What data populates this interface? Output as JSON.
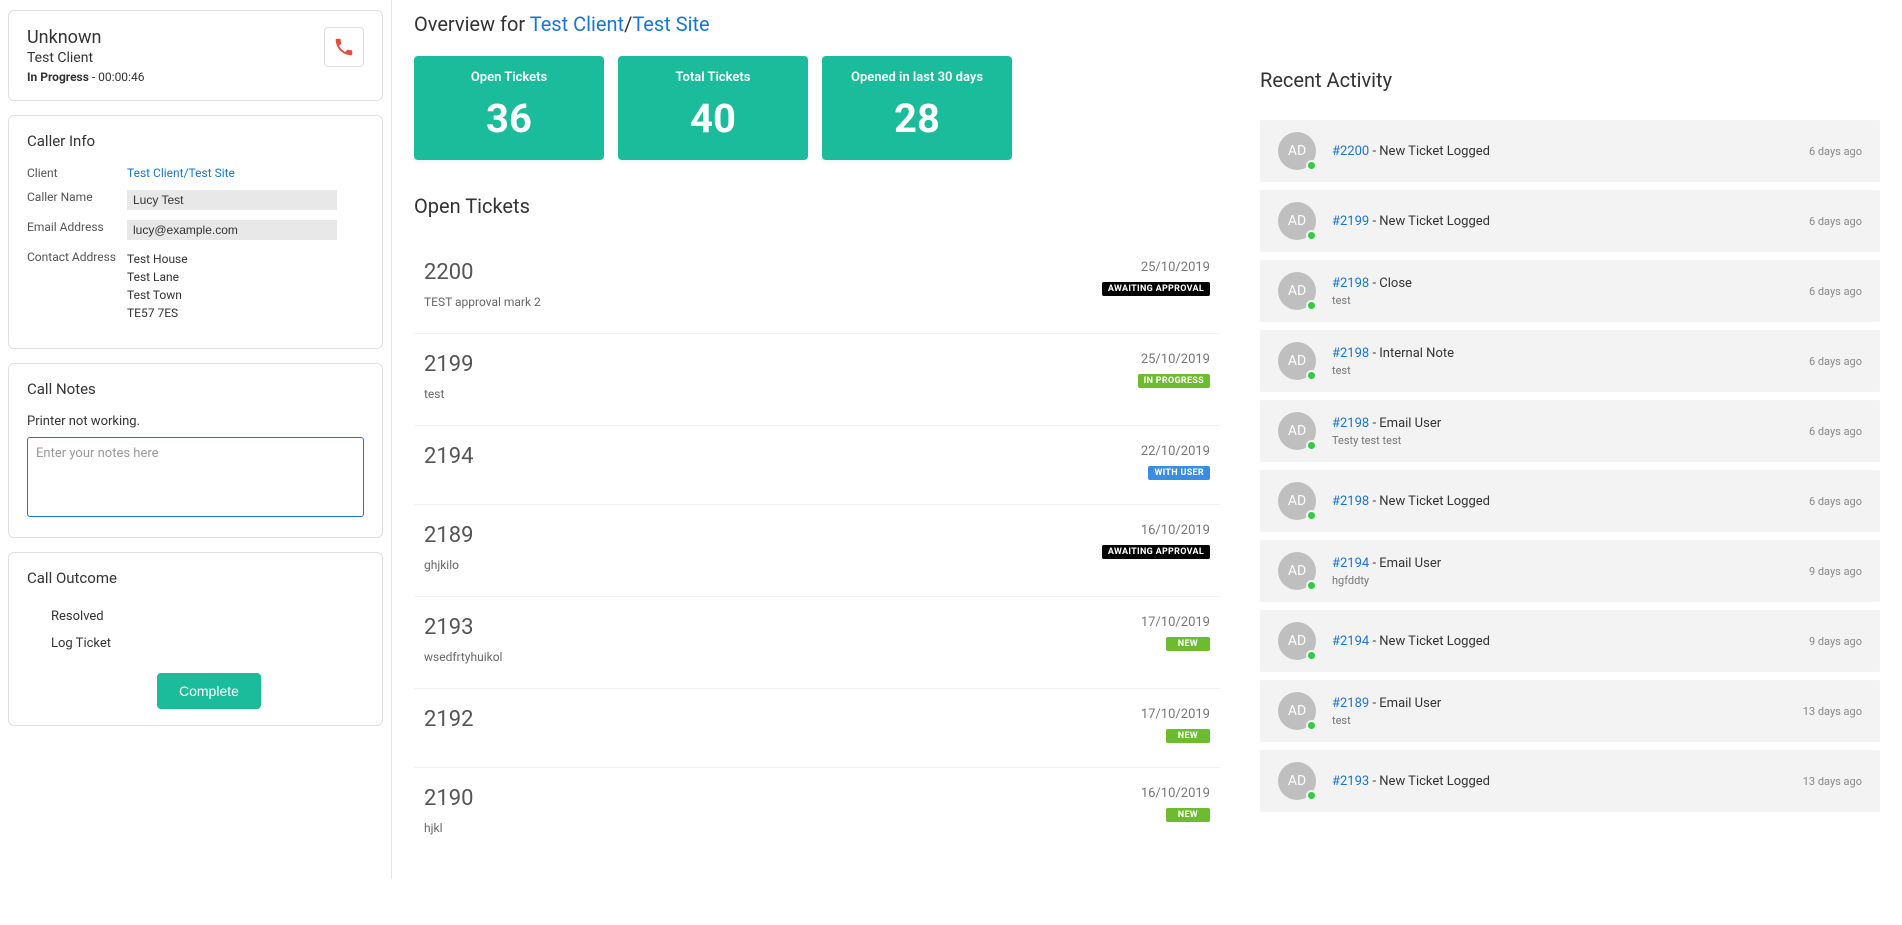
{
  "caller": {
    "name": "Unknown",
    "client": "Test Client",
    "status_label": "In Progress",
    "duration": "00:00:46"
  },
  "caller_info": {
    "heading": "Caller Info",
    "client_label": "Client",
    "client_link": "Test Client/Test Site",
    "name_label": "Caller Name",
    "name_value": "Lucy Test",
    "email_label": "Email Address",
    "email_value": "lucy@example.com",
    "address_label": "Contact Address",
    "address": [
      "Test House",
      "Test Lane",
      "Test Town",
      "TE57 7ES"
    ]
  },
  "call_notes": {
    "heading": "Call Notes",
    "existing": "Printer not working.",
    "placeholder": "Enter your notes here"
  },
  "call_outcome": {
    "heading": "Call Outcome",
    "options": [
      "Resolved",
      "Log Ticket"
    ],
    "complete_label": "Complete"
  },
  "overview": {
    "prefix": "Overview for ",
    "client": "Test Client",
    "sep": "/",
    "site": "Test Site"
  },
  "stats": [
    {
      "label": "Open Tickets",
      "value": "36"
    },
    {
      "label": "Total Tickets",
      "value": "40"
    },
    {
      "label": "Opened in last 30 days",
      "value": "28"
    }
  ],
  "open_tickets_heading": "Open Tickets",
  "tickets": [
    {
      "num": "2200",
      "desc": "TEST approval mark 2",
      "date": "25/10/2019",
      "badge": "AWAITING APPROVAL",
      "badge_cls": "awaiting"
    },
    {
      "num": "2199",
      "desc": "test",
      "date": "25/10/2019",
      "badge": "IN PROGRESS",
      "badge_cls": "inprogress"
    },
    {
      "num": "2194",
      "desc": "",
      "date": "22/10/2019",
      "badge": "WITH USER",
      "badge_cls": "withuser"
    },
    {
      "num": "2189",
      "desc": "ghjkilo",
      "date": "16/10/2019",
      "badge": "AWAITING APPROVAL",
      "badge_cls": "awaiting"
    },
    {
      "num": "2193",
      "desc": "wsedfrtyhuikol",
      "date": "17/10/2019",
      "badge": "NEW",
      "badge_cls": "new"
    },
    {
      "num": "2192",
      "desc": "",
      "date": "17/10/2019",
      "badge": "NEW",
      "badge_cls": "new"
    },
    {
      "num": "2190",
      "desc": "hjkl",
      "date": "16/10/2019",
      "badge": "NEW",
      "badge_cls": "new"
    }
  ],
  "recent_heading": "Recent Activity",
  "avatar_initials": "AD",
  "activity": [
    {
      "ticket": "#2200",
      "action": "New Ticket Logged",
      "sub": "",
      "time": "6 days ago"
    },
    {
      "ticket": "#2199",
      "action": "New Ticket Logged",
      "sub": "",
      "time": "6 days ago"
    },
    {
      "ticket": "#2198",
      "action": "Close",
      "sub": "test",
      "time": "6 days ago"
    },
    {
      "ticket": "#2198",
      "action": "Internal Note",
      "sub": "test",
      "time": "6 days ago"
    },
    {
      "ticket": "#2198",
      "action": "Email User",
      "sub": "Testy test test",
      "time": "6 days ago"
    },
    {
      "ticket": "#2198",
      "action": "New Ticket Logged",
      "sub": "",
      "time": "6 days ago"
    },
    {
      "ticket": "#2194",
      "action": "Email User",
      "sub": "hgfddty",
      "time": "9 days ago"
    },
    {
      "ticket": "#2194",
      "action": "New Ticket Logged",
      "sub": "",
      "time": "9 days ago"
    },
    {
      "ticket": "#2189",
      "action": "Email User",
      "sub": "test",
      "time": "13 days ago"
    },
    {
      "ticket": "#2193",
      "action": "New Ticket Logged",
      "sub": "",
      "time": "13 days ago"
    }
  ]
}
